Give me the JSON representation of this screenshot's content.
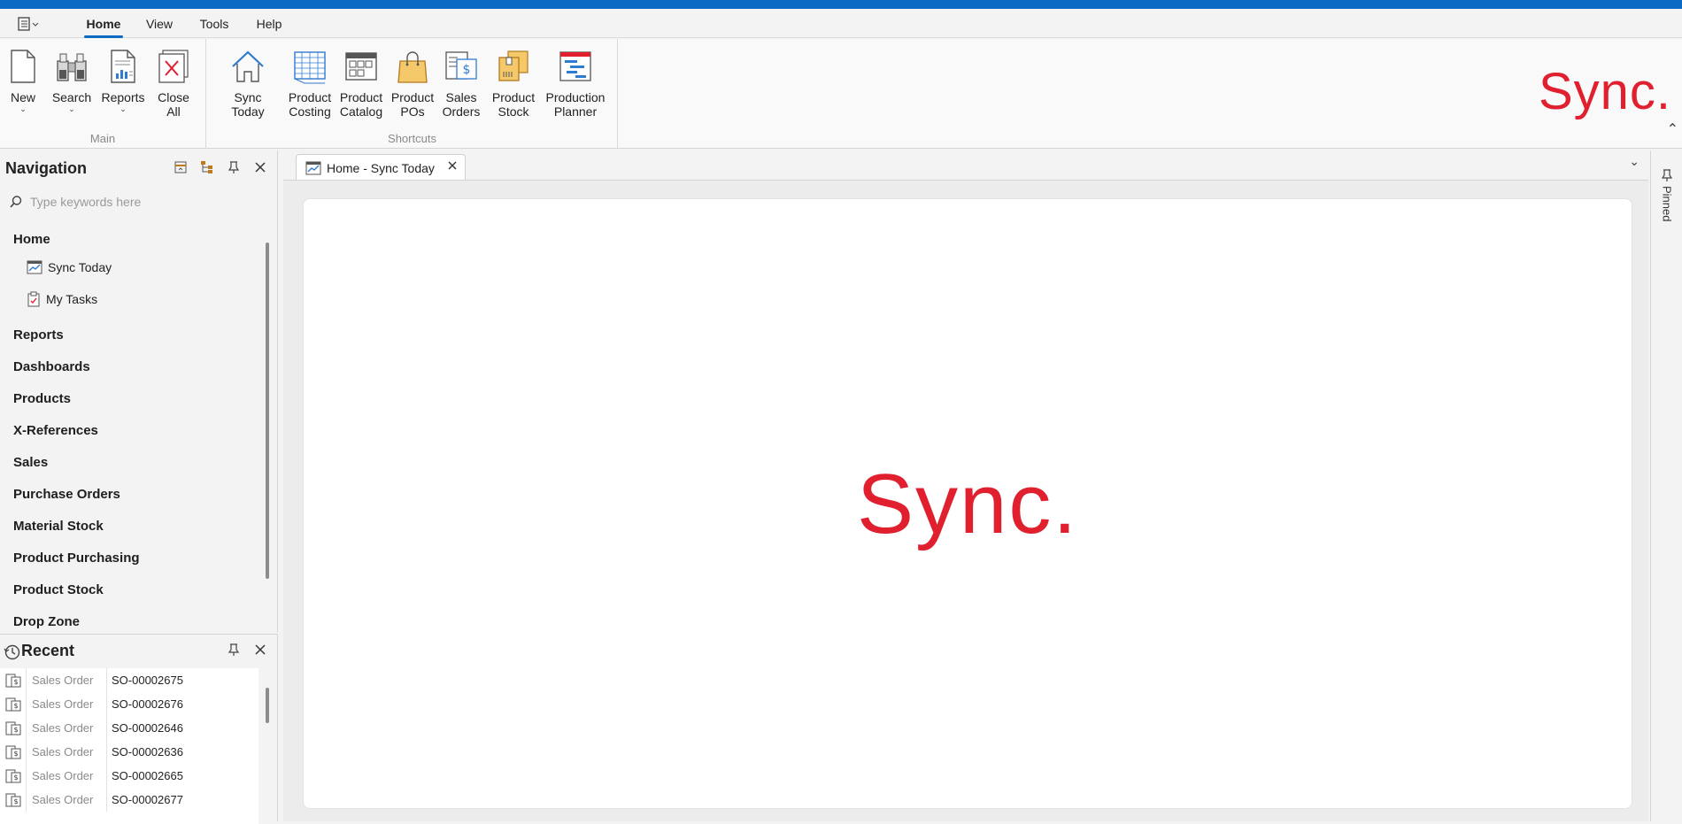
{
  "menu": {
    "tabs": [
      {
        "label": "Home",
        "active": true
      },
      {
        "label": "View",
        "active": false
      },
      {
        "label": "Tools",
        "active": false
      },
      {
        "label": "Help",
        "active": false
      }
    ]
  },
  "ribbon": {
    "groups": {
      "main": {
        "label": "Main",
        "buttons": [
          {
            "line1": "New",
            "line2": ""
          },
          {
            "line1": "Search",
            "line2": ""
          },
          {
            "line1": "Reports",
            "line2": ""
          },
          {
            "line1": "Close",
            "line2": "All"
          }
        ]
      },
      "shortcuts": {
        "label": "Shortcuts",
        "buttons": [
          {
            "line1": "Sync Today",
            "line2": ""
          },
          {
            "line1": "Product",
            "line2": "Costing"
          },
          {
            "line1": "Product",
            "line2": "Catalog"
          },
          {
            "line1": "Product",
            "line2": "POs"
          },
          {
            "line1": "Sales",
            "line2": "Orders"
          },
          {
            "line1": "Product",
            "line2": "Stock"
          },
          {
            "line1": "Production",
            "line2": "Planner"
          }
        ]
      }
    },
    "brand": "Sync."
  },
  "navigation": {
    "title": "Navigation",
    "search_placeholder": "Type keywords here",
    "sections": [
      {
        "label": "Home"
      },
      {
        "label": "Reports"
      },
      {
        "label": "Dashboards"
      },
      {
        "label": "Products"
      },
      {
        "label": "X-References"
      },
      {
        "label": "Sales"
      },
      {
        "label": "Purchase Orders"
      },
      {
        "label": "Material Stock"
      },
      {
        "label": "Product Purchasing"
      },
      {
        "label": "Product Stock"
      },
      {
        "label": "Drop Zone"
      }
    ],
    "home_items": [
      {
        "label": "Sync Today"
      },
      {
        "label": "My Tasks"
      }
    ]
  },
  "recent": {
    "title": "Recent",
    "rows": [
      {
        "type": "Sales Order",
        "number": "SO-00002675"
      },
      {
        "type": "Sales Order",
        "number": "SO-00002676"
      },
      {
        "type": "Sales Order",
        "number": "SO-00002646"
      },
      {
        "type": "Sales Order",
        "number": "SO-00002636"
      },
      {
        "type": "Sales Order",
        "number": "SO-00002665"
      },
      {
        "type": "Sales Order",
        "number": "SO-00002677"
      }
    ]
  },
  "document": {
    "tab_title": "Home - Sync Today",
    "brand": "Sync."
  },
  "pinned": {
    "label": "Pinned"
  },
  "colors": {
    "accent": "#0a6ac4",
    "brand_red": "#e0202e"
  }
}
